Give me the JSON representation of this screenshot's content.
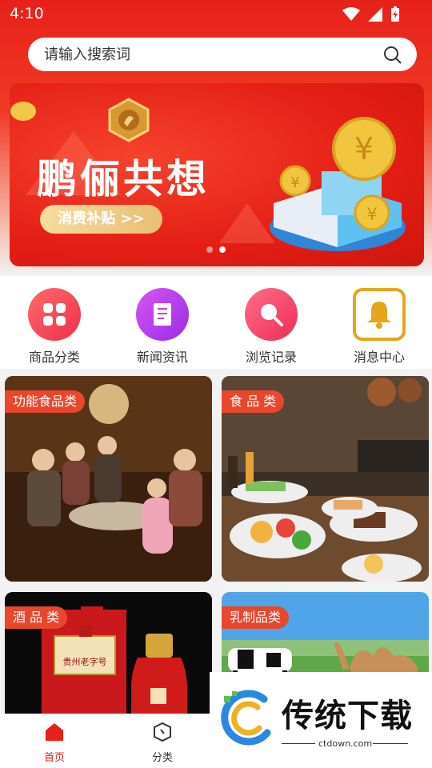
{
  "status": {
    "time": "4:10"
  },
  "search": {
    "placeholder": "请输入搜索词"
  },
  "banner": {
    "title": "鹏俪共想",
    "button": "消费补贴 >>",
    "active_dot": 2,
    "dot_count": 2
  },
  "quick": [
    {
      "label": "商品分类",
      "icon": "grid-icon"
    },
    {
      "label": "新闻资讯",
      "icon": "news-icon"
    },
    {
      "label": "浏览记录",
      "icon": "search-history-icon"
    },
    {
      "label": "消息中心",
      "icon": "bell-icon"
    }
  ],
  "categories": [
    {
      "tag": "功能食品类",
      "image": "family-with-bottles-photo"
    },
    {
      "tag": "食 品 类",
      "image": "food-table-photo"
    },
    {
      "tag": "酒 品 类",
      "image": "liquor-bottle-photo"
    },
    {
      "tag": "乳制品类",
      "image": "grassland-cow-camel-photo"
    }
  ],
  "liquor_label": "贵州老字号",
  "nav": [
    {
      "label": "首页",
      "icon": "home-icon",
      "active": true
    },
    {
      "label": "分类",
      "icon": "category-icon",
      "active": false
    }
  ],
  "watermark": {
    "text": "传统下载",
    "url": "ctdown.com"
  },
  "colors": {
    "primary": "#e8201a",
    "tag": "#e8472e",
    "nav_active": "#e8201a"
  }
}
